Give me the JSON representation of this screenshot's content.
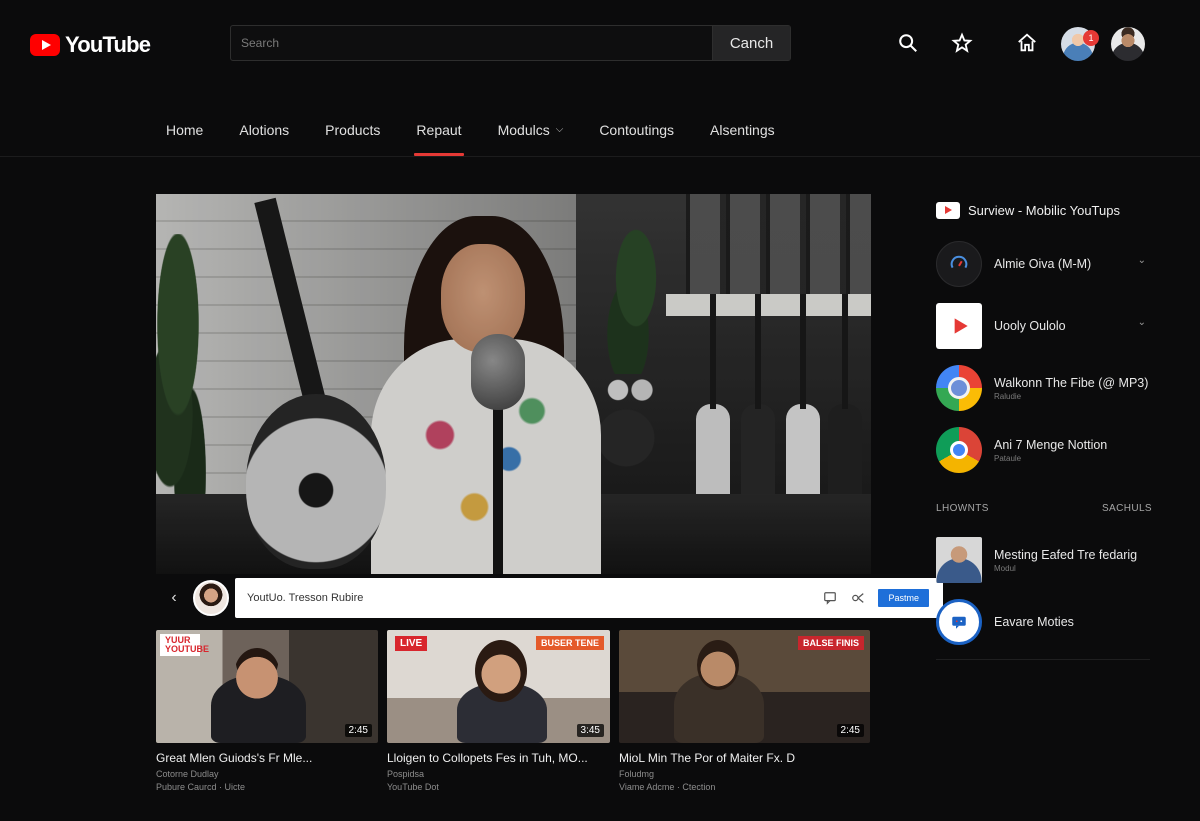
{
  "header": {
    "logo_text": "YouTube",
    "search_placeholder": "Search",
    "search_button": "Canch",
    "notification_count": "1"
  },
  "nav": {
    "tabs": [
      {
        "label": "Home"
      },
      {
        "label": "Alotions"
      },
      {
        "label": "Products"
      },
      {
        "label": "Repaut",
        "active": true
      },
      {
        "label": "Modulcs",
        "dropdown": true
      },
      {
        "label": "Contoutings"
      },
      {
        "label": "Alsentings"
      }
    ]
  },
  "player": {
    "title": "YoutUo. Tresson Rubire",
    "feature_button": "Pastme"
  },
  "thumbnails": [
    {
      "badge": "YUUR YOUTUBE",
      "duration": "2:45",
      "title": "Great Mlen Guiods's Fr Mle...",
      "channel": "Cotorne Dudlay",
      "meta": "Pubure Caurcd · Uicte"
    },
    {
      "badge": "LIVE",
      "badge2": "BUSER TENE",
      "duration": "3:45",
      "title": "Lloigen to Collopets Fes in Tuh, MO...",
      "channel": "Pospidsa",
      "meta": "YouTube Dot"
    },
    {
      "badge": "BALSE FINIS",
      "duration": "2:45",
      "title": "MioL Min The Por of Maiter Fx. D",
      "channel": "Foludmg",
      "meta": "Viame Adcme · Ctection"
    }
  ],
  "sidebar": {
    "header_title": "Surview - Mobilic YouTups",
    "items": [
      {
        "title": "Almie Oiva (M-M)",
        "sub": "",
        "icon": "gauge-icon",
        "has_chevron": true
      },
      {
        "title": "Uooly Oulolo",
        "sub": "",
        "icon": "youtube-play-icon",
        "has_chevron": true
      },
      {
        "title": "Walkonn The Fibe (@ MP3)",
        "sub": "Raludie",
        "icon": "google-photos-icon",
        "has_chevron": false
      },
      {
        "title": "Ani 7 Menge Nottion",
        "sub": "Pataule",
        "icon": "chrome-icon",
        "has_chevron": false
      }
    ],
    "section": {
      "left": "LHOWNTS",
      "right": "SACHULS"
    },
    "section_items": [
      {
        "title": "Mesting Eafed Tre fedarig",
        "sub": "Modul",
        "icon": "person-photo-icon"
      },
      {
        "title": "Eavare Moties",
        "sub": "",
        "icon": "message-icon"
      }
    ]
  },
  "colors": {
    "background": "#0b0b0c",
    "accent": "#e53935",
    "brand_red": "#ff0000",
    "feature_blue": "#1e6fd9"
  }
}
